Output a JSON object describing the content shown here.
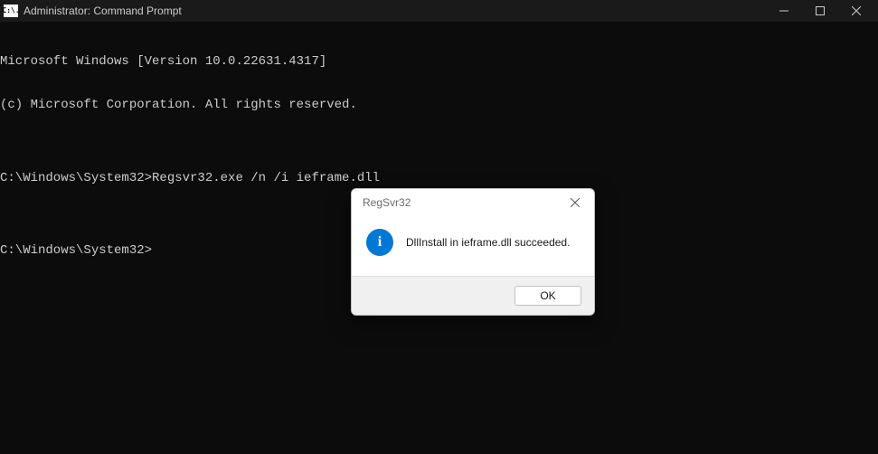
{
  "window": {
    "title": "Administrator: Command Prompt",
    "icon_text": "C:\\."
  },
  "terminal": {
    "line1": "Microsoft Windows [Version 10.0.22631.4317]",
    "line2": "(c) Microsoft Corporation. All rights reserved.",
    "blank1": "",
    "line3": "C:\\Windows\\System32>Regsvr32.exe /n /i ieframe.dll",
    "blank2": "",
    "line4": "C:\\Windows\\System32>"
  },
  "dialog": {
    "title": "RegSvr32",
    "message": "DllInstall in ieframe.dll succeeded.",
    "ok_label": "OK",
    "info_glyph": "i"
  }
}
